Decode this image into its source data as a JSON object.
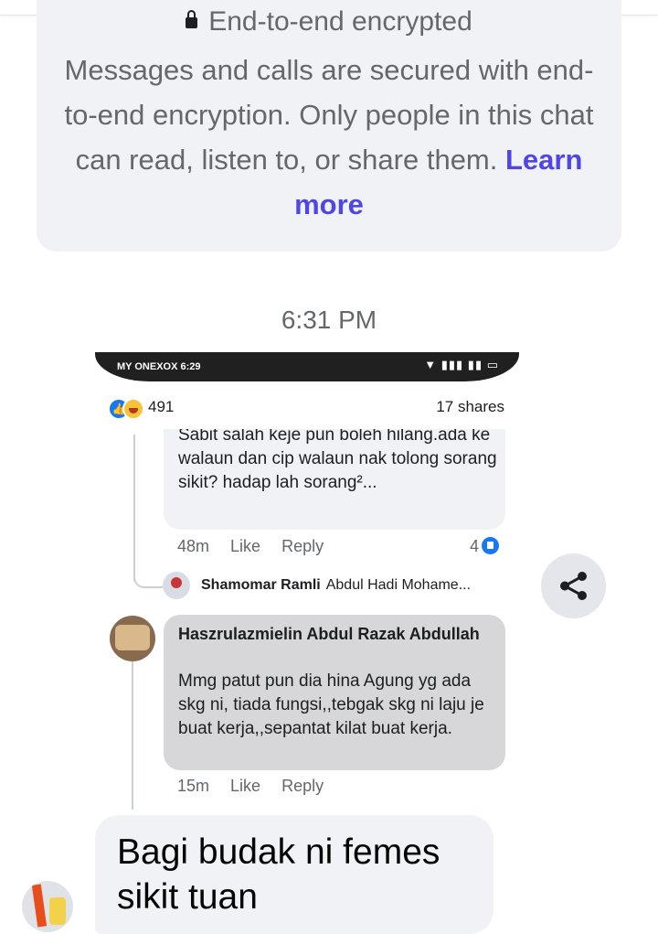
{
  "encryption": {
    "title": "End-to-end encrypted",
    "body": "Messages and calls are secured with end-to-end encryption. Only people in this chat can read, listen to, or share them.",
    "link": "Learn more"
  },
  "timestamp": "6:31 PM",
  "shared_screenshot": {
    "status_bar": {
      "carrier": "MY ONEXOX",
      "time": "6:29"
    },
    "reactions_count": "491",
    "shares": "17 shares",
    "comment1": {
      "text": "Sabit salah keje pun boleh hilang.ada ke walaun dan cip walaun nak tolong sorang sikit? hadap lah sorang²...",
      "time": "48m",
      "like": "Like",
      "reply": "Reply",
      "likes": "4"
    },
    "reply_preview": {
      "name": "Shamomar Ramli",
      "text": "Abdul Hadi Mohame..."
    },
    "comment2": {
      "name": "Haszrulazmielin Abdul Razak Abdullah",
      "text": "Mmg patut pun dia hina Agung yg ada skg ni, tiada fungsi,,tebgak skg ni laju je buat kerja,,sepantat kilat buat kerja.",
      "time": "15m",
      "like": "Like",
      "reply": "Reply"
    }
  },
  "message": {
    "text": "Bagi budak ni femes sikit tuan"
  },
  "icons": {
    "lock": "lock-icon",
    "share": "share-icon"
  }
}
